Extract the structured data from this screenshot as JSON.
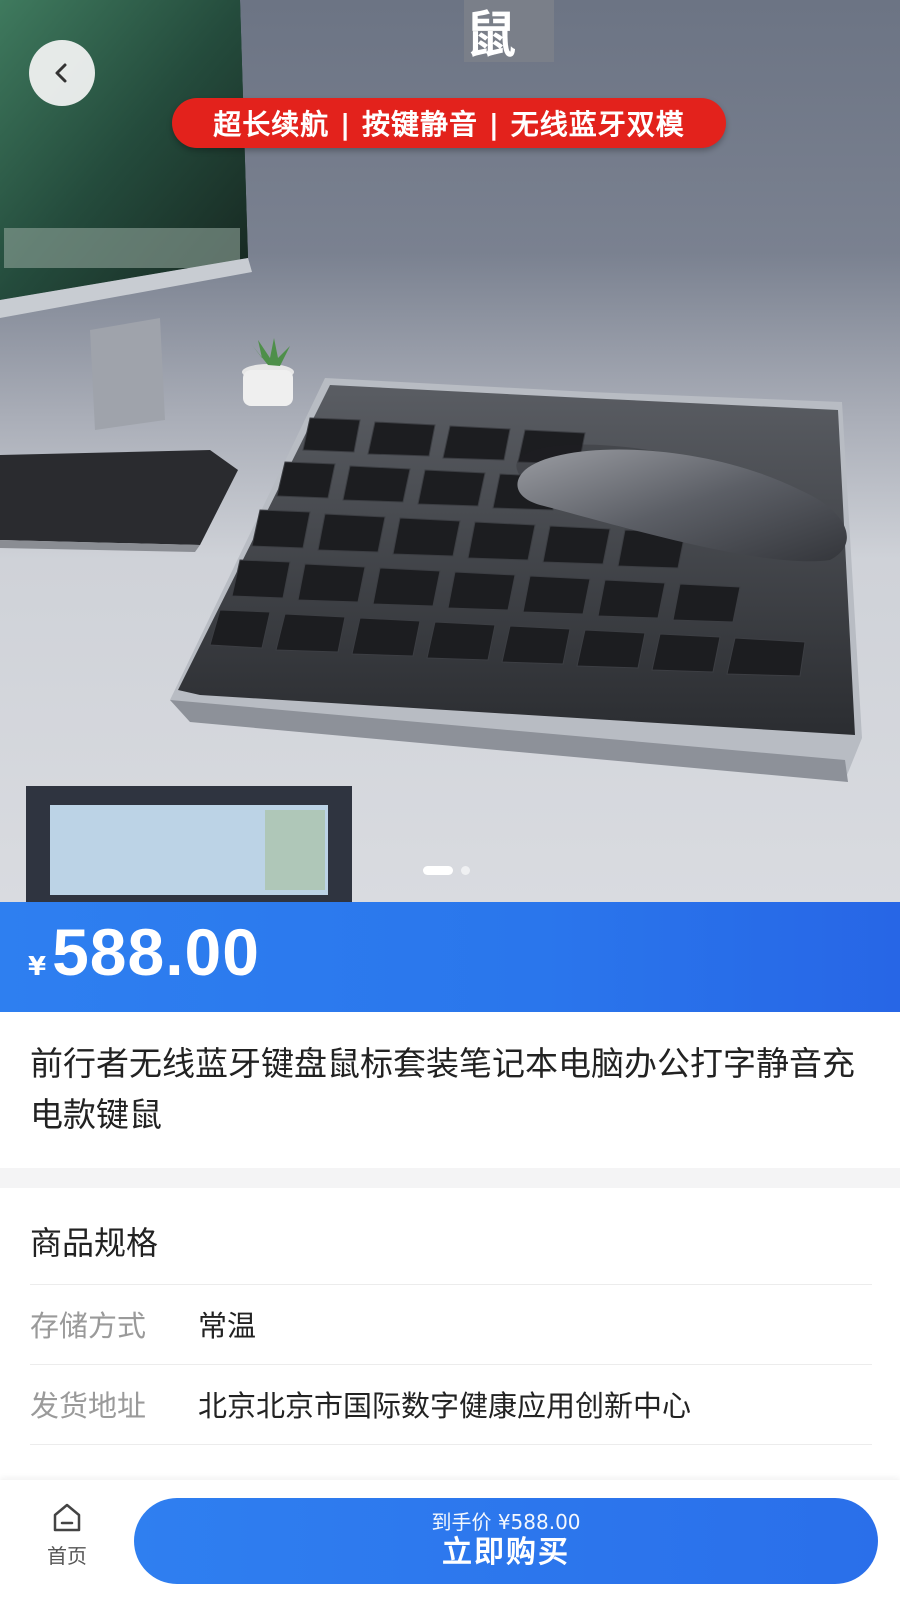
{
  "hero": {
    "banner_text": "超长续航 | 按键静音 | 无线蓝牙双模",
    "slide_count": 2,
    "active_slide": 1
  },
  "price": {
    "currency": "¥",
    "amount": "588.00"
  },
  "product": {
    "title": "前行者无线蓝牙键盘鼠标套装笔记本电脑办公打字静音充电款键鼠"
  },
  "specs": {
    "heading": "商品规格",
    "rows": [
      {
        "label": "存储方式",
        "value": "常温"
      },
      {
        "label": "发货地址",
        "value": "北京北京市国际数字健康应用创新中心"
      }
    ]
  },
  "bottom_bar": {
    "home_label": "首页",
    "buy_price_text": "到手价 ¥588.00",
    "buy_label": "立即购买"
  },
  "colors": {
    "accent_blue": "#2a76ec",
    "banner_red": "#e3221c"
  },
  "icons": {
    "back": "chevron-left-icon",
    "home": "home-icon"
  }
}
